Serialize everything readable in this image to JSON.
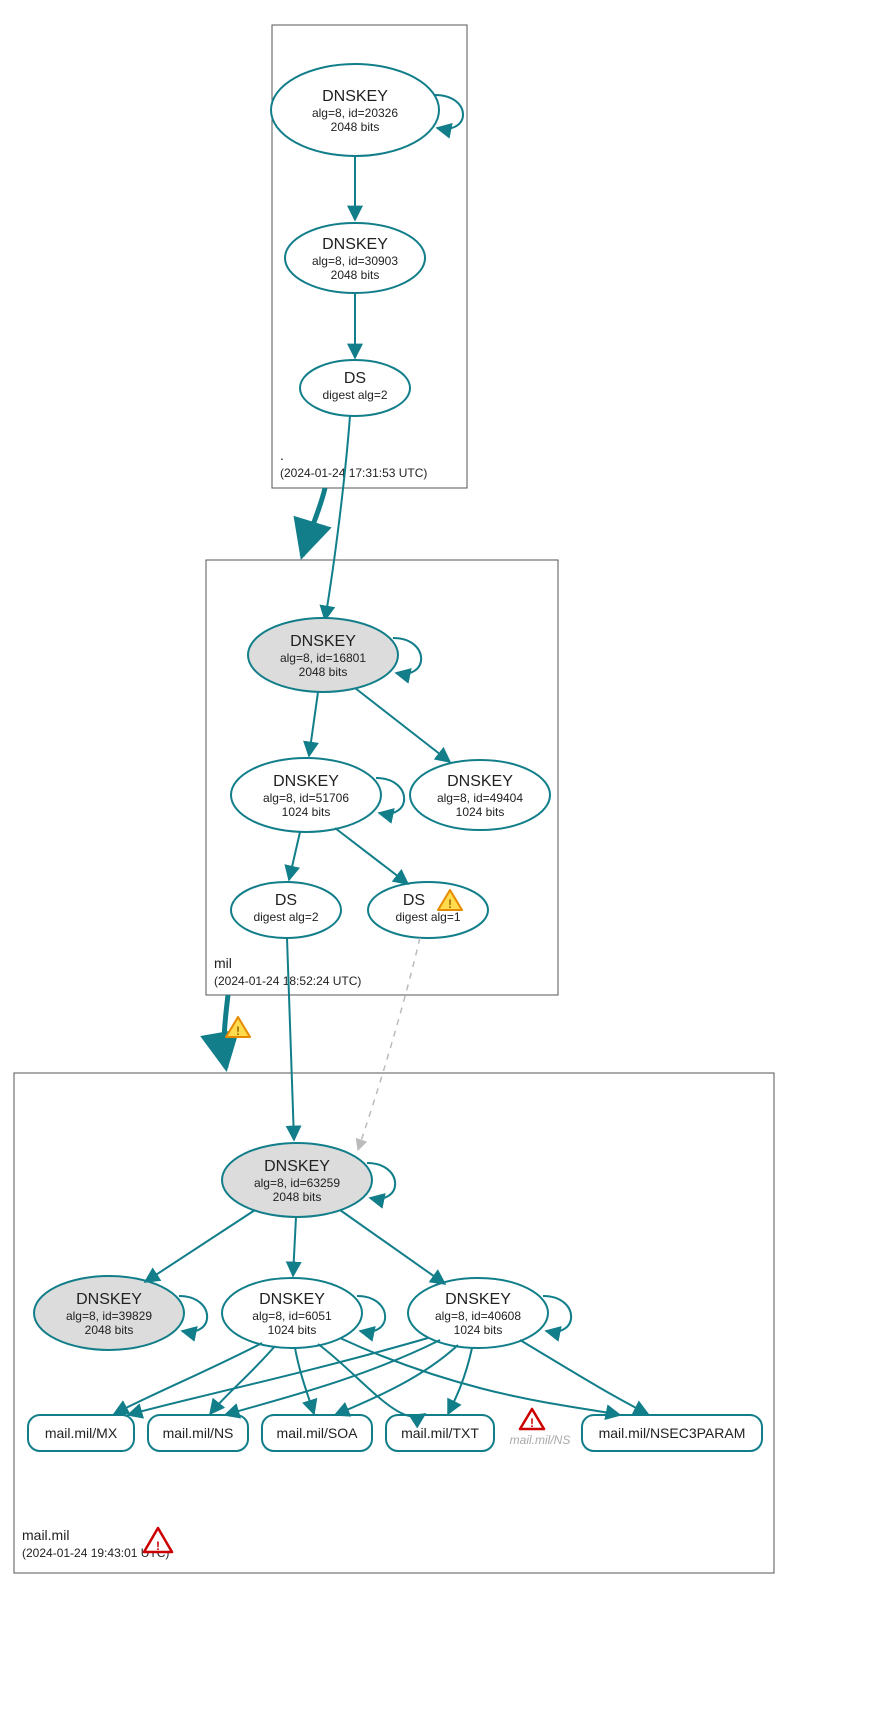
{
  "colors": {
    "accent": "#117e8a",
    "node_fill_grey": "#dcdcdc"
  },
  "zones": {
    "root": {
      "name": ".",
      "timestamp": "(2024-01-24 17:31:53 UTC)"
    },
    "mil": {
      "name": "mil",
      "timestamp": "(2024-01-24 18:52:24 UTC)"
    },
    "mailmil": {
      "name": "mail.mil",
      "timestamp": "(2024-01-24 19:43:01 UTC)"
    }
  },
  "nodes": {
    "root_ksk": {
      "title": "DNSKEY",
      "line2": "alg=8, id=20326",
      "line3": "2048 bits"
    },
    "root_zsk": {
      "title": "DNSKEY",
      "line2": "alg=8, id=30903",
      "line3": "2048 bits"
    },
    "root_ds": {
      "title": "DS",
      "line2": "digest alg=2"
    },
    "mil_ksk": {
      "title": "DNSKEY",
      "line2": "alg=8, id=16801",
      "line3": "2048 bits"
    },
    "mil_zsk1": {
      "title": "DNSKEY",
      "line2": "alg=8, id=51706",
      "line3": "1024 bits"
    },
    "mil_zsk2": {
      "title": "DNSKEY",
      "line2": "alg=8, id=49404",
      "line3": "1024 bits"
    },
    "mil_ds1": {
      "title": "DS",
      "line2": "digest alg=2"
    },
    "mil_ds2": {
      "title": "DS",
      "line2": "digest alg=1"
    },
    "mm_ksk": {
      "title": "DNSKEY",
      "line2": "alg=8, id=63259",
      "line3": "2048 bits"
    },
    "mm_key2": {
      "title": "DNSKEY",
      "line2": "alg=8, id=39829",
      "line3": "2048 bits"
    },
    "mm_zsk1": {
      "title": "DNSKEY",
      "line2": "alg=8, id=6051",
      "line3": "1024 bits"
    },
    "mm_zsk2": {
      "title": "DNSKEY",
      "line2": "alg=8, id=40608",
      "line3": "1024 bits"
    }
  },
  "rrsets": {
    "mx": "mail.mil/MX",
    "ns": "mail.mil/NS",
    "soa": "mail.mil/SOA",
    "txt": "mail.mil/TXT",
    "ghost": "mail.mil/NS",
    "nsec3": "mail.mil/NSEC3PARAM"
  }
}
